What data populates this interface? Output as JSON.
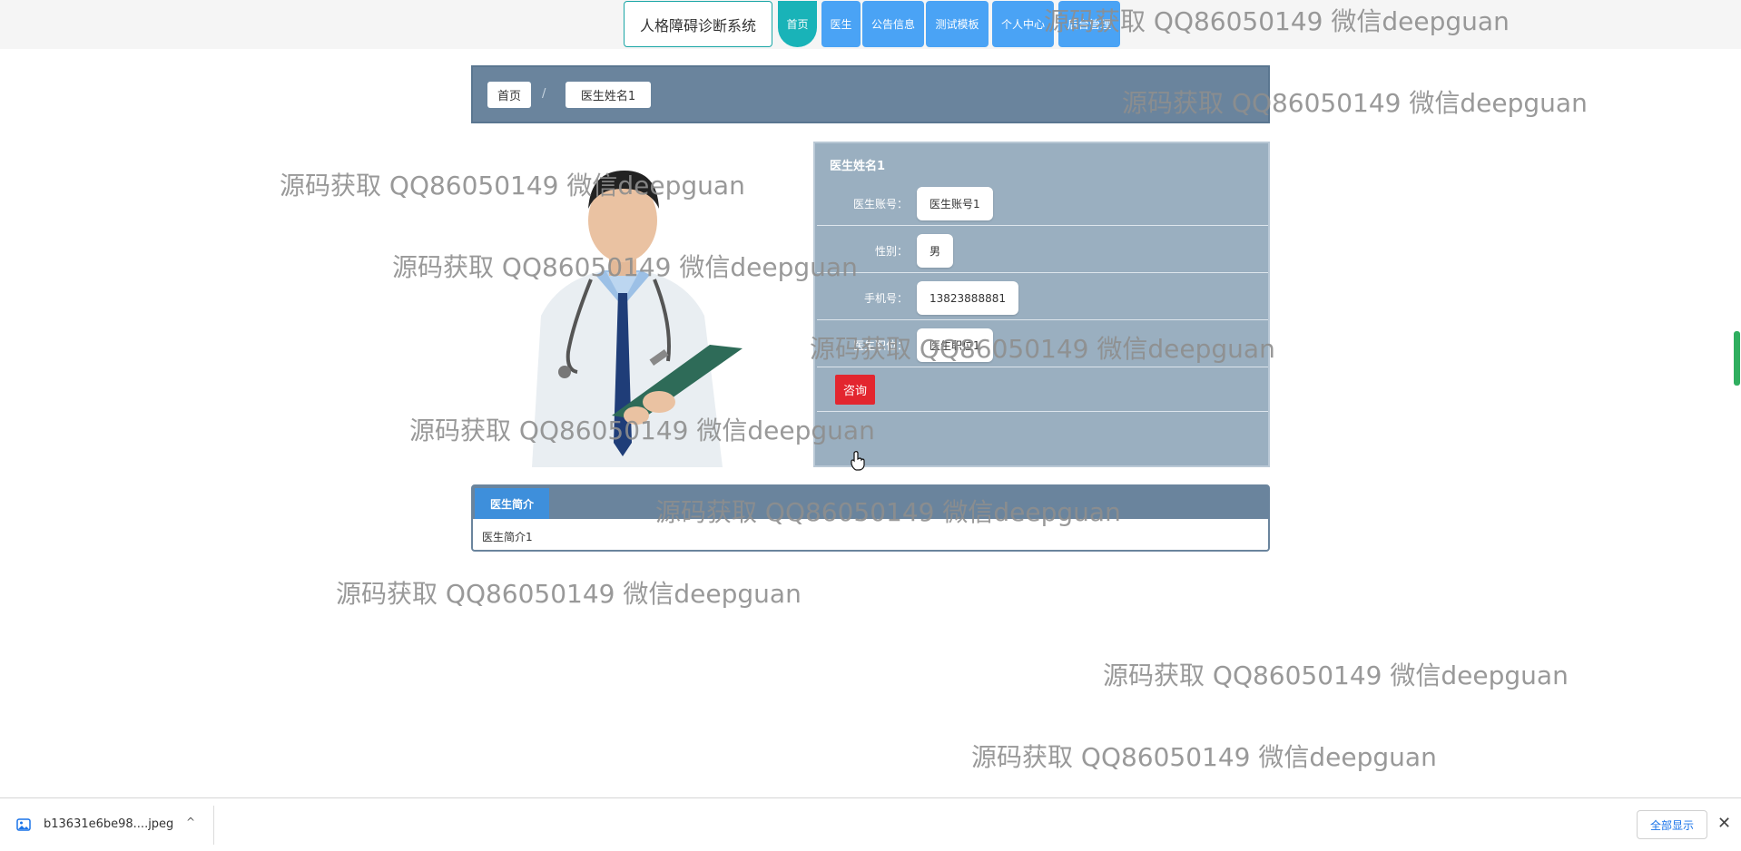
{
  "nav": {
    "brand": "人格障碍诊断系统",
    "items": [
      "首页",
      "医生",
      "公告信息",
      "测试模板",
      "个人中心",
      "后台管理"
    ]
  },
  "breadcrumb": {
    "home": "首页",
    "separator": "/",
    "current": "医生姓名1"
  },
  "doctor": {
    "name": "医生姓名1",
    "fields": [
      {
        "label": "医生账号：",
        "value": "医生账号1"
      },
      {
        "label": "性别：",
        "value": "男"
      },
      {
        "label": "手机号：",
        "value": "13823888881"
      },
      {
        "label": "医生职位：",
        "value": "医生职位1"
      }
    ],
    "consult_label": "咨询"
  },
  "intro": {
    "tab": "医生简介",
    "text": "医生简介1"
  },
  "watermark": "源码获取 QQ86050149 微信deepguan",
  "download": {
    "filename": "b13631e6be98....jpeg",
    "show_all": "全部显示",
    "close": "✕",
    "chevron": "^"
  },
  "colors": {
    "nav_blue": "#4aa3f5",
    "nav_teal": "#19b3b8",
    "panel_slate": "#6a849d",
    "consult_red": "#e3262f"
  }
}
